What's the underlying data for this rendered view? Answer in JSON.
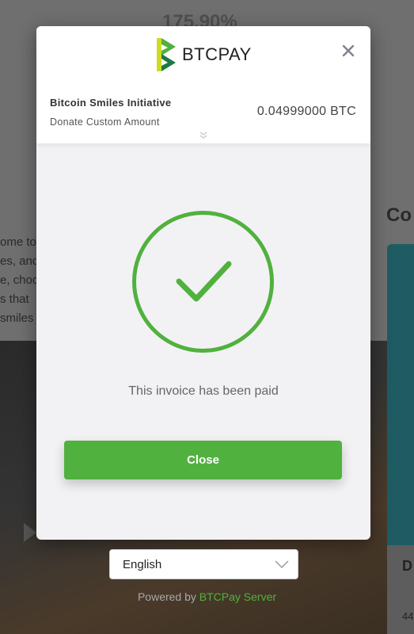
{
  "background": {
    "percent": "175.90%",
    "text_lines": [
      "ome to",
      "es, and",
      "e, choo",
      "s that",
      "smiles"
    ],
    "right_heading": "Co",
    "right_card_letter": "D",
    "right_card_number": "44"
  },
  "modal": {
    "logo_text": "BTCPAY",
    "store_name": "Bitcoin Smiles Initiative",
    "item_description": "Donate Custom Amount",
    "amount": "0.04999000 BTC",
    "status_text": "This invoice has been paid",
    "close_button_label": "Close"
  },
  "footer": {
    "language": "English",
    "powered_by_prefix": "Powered by ",
    "powered_by_link": "BTCPay Server"
  },
  "colors": {
    "accent_green": "#51b13e",
    "modal_bg": "#f2f2f4"
  },
  "icons": {
    "close": "close-icon",
    "expand": "chevron-double-down-icon",
    "success": "checkmark-circle-icon",
    "dropdown": "chevron-down-icon"
  }
}
